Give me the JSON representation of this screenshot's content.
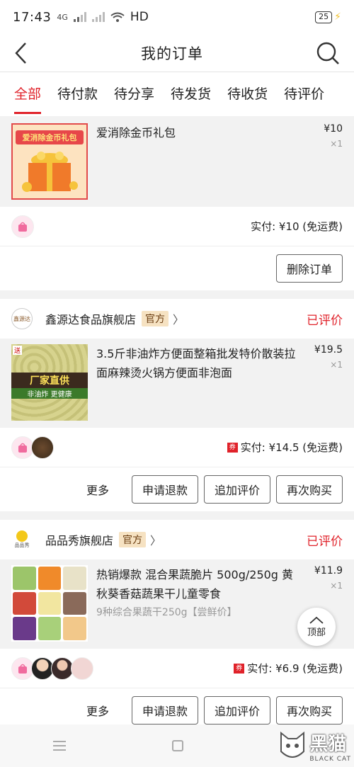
{
  "status_bar": {
    "time": "17:43",
    "network": "4G",
    "wifi_label": "HD",
    "battery": "25"
  },
  "header": {
    "title": "我的订单"
  },
  "tabs": [
    {
      "label": "全部"
    },
    {
      "label": "待付款"
    },
    {
      "label": "待分享"
    },
    {
      "label": "待发货"
    },
    {
      "label": "待收货"
    },
    {
      "label": "待评价"
    }
  ],
  "orders": [
    {
      "product": {
        "title": "爱消除金币礼包",
        "price": "¥10",
        "qty": "×1",
        "thumb_text": "爱消除金币礼包"
      },
      "pay_label": "实付: ¥10 (免运费)",
      "actions": [
        "删除订单"
      ]
    },
    {
      "shop": {
        "name": "鑫源达食品旗舰店",
        "badge": "官方",
        "status": "已评价",
        "logo_text": "鑫源达"
      },
      "product": {
        "title": "3.5斤非油炸方便面整箱批发特价散装拉面麻辣烫火锅方便面非泡面",
        "price": "¥19.5",
        "qty": "×1",
        "thumb_tag1": "厂家直供",
        "thumb_tag2": "非油炸 更健康",
        "thumb_corner": "送"
      },
      "coupon": "券",
      "pay_label": "实付: ¥14.5 (免运费)",
      "more": "更多",
      "actions": [
        "申请退款",
        "追加评价",
        "再次购买"
      ]
    },
    {
      "shop": {
        "name": "品品秀旗舰店",
        "badge": "官方",
        "status": "已评价",
        "logo_text": "品品秀"
      },
      "product": {
        "title": "热销爆款 混合果蔬脆片 500g/250g 黄秋葵香菇蔬果干儿童零食",
        "desc": "9种综合果蔬干250g【尝鲜价】",
        "price": "¥11.9",
        "qty": "×1"
      },
      "coupon": "券",
      "pay_label": "实付: ¥6.9 (免运费)",
      "more": "更多",
      "actions": [
        "申请退款",
        "追加评价",
        "再次购买"
      ]
    }
  ],
  "back_to_top": "顶部",
  "watermark": {
    "text": "黑猫",
    "sub": "BLACK CAT"
  },
  "colors": {
    "accent": "#e0222a",
    "badge_bg": "#f6e2c2"
  }
}
